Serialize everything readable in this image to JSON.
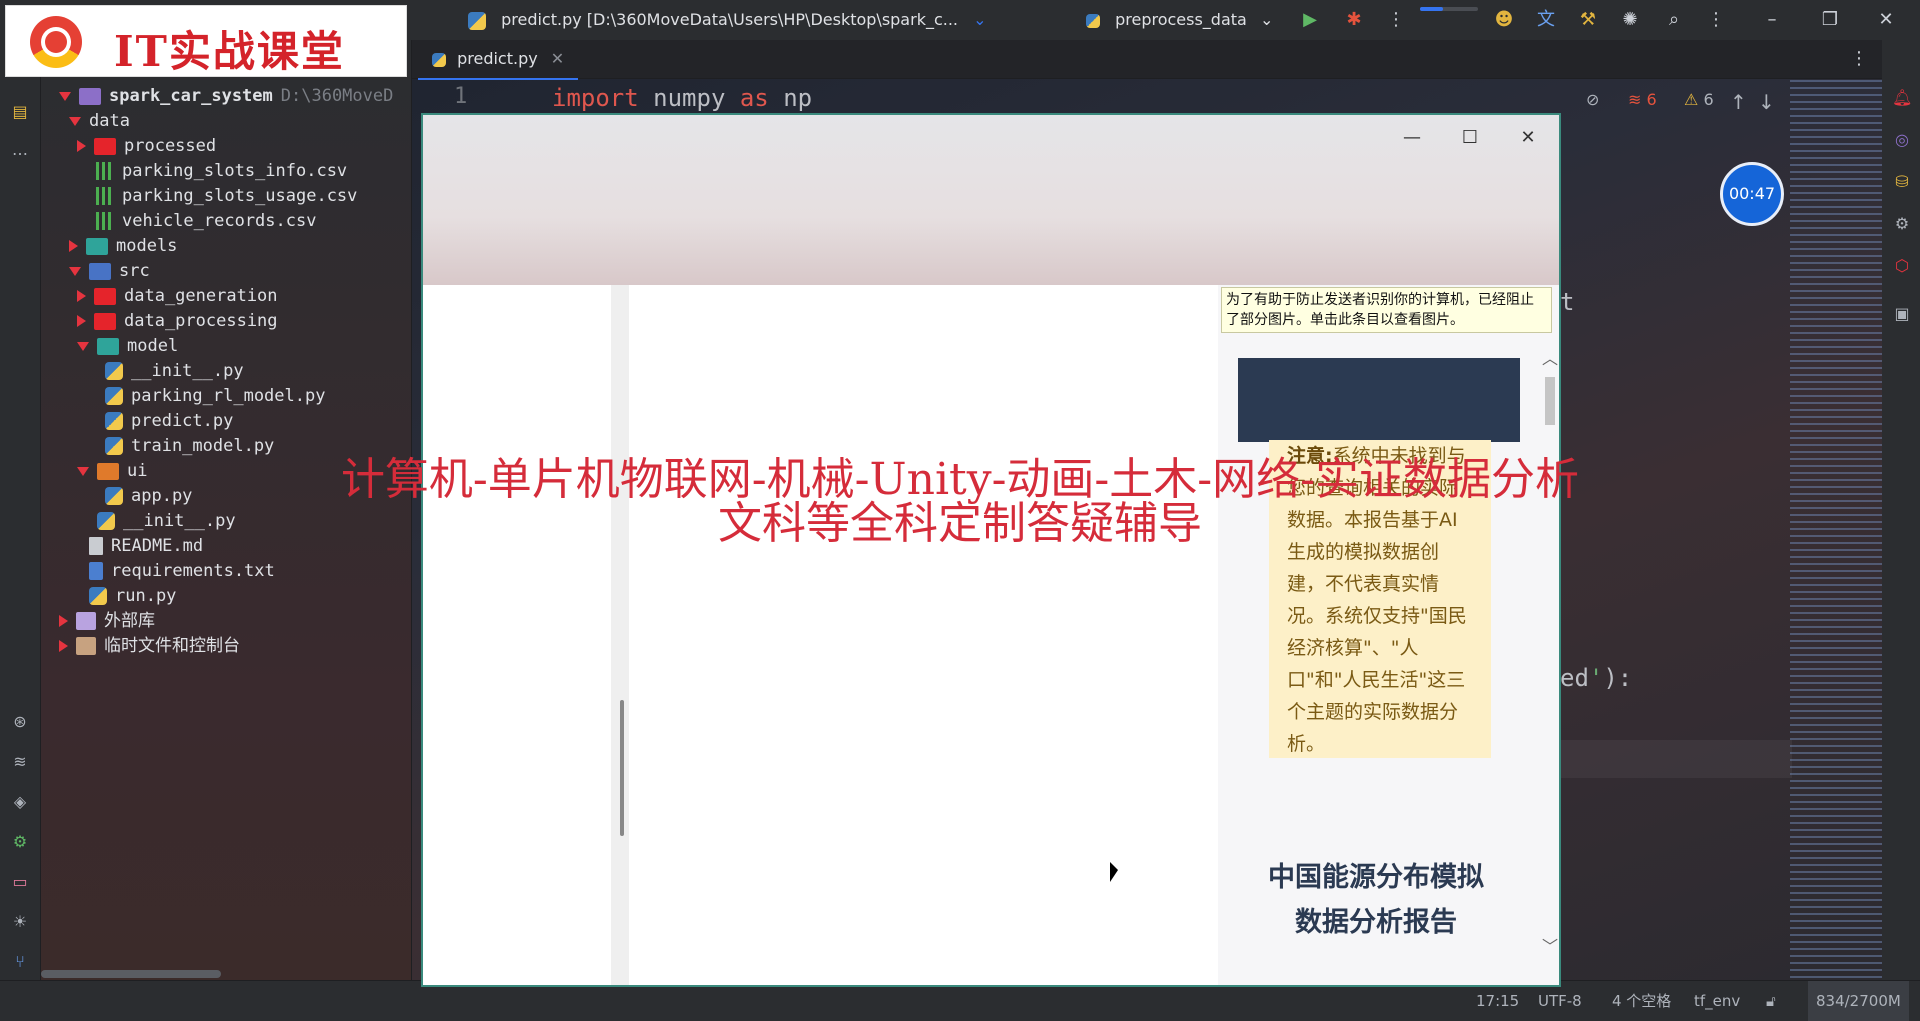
{
  "watermark": {
    "logo_text": "IT实战课堂",
    "overlay_line1": "计算机-单片机物联网-机械-Unity-动画-土木-网络-实证数据分析",
    "overlay_line2": "文科等全科定制答疑辅导"
  },
  "topbar": {
    "file_title": "predict.py [D:\\360MoveData\\Users\\HP\\Desktop\\spark_c...",
    "run_config": "preprocess_data",
    "icons": [
      "python-icon",
      "chevron-down-icon",
      "run-icon",
      "debug-icon",
      "more-icon",
      "collab-icon",
      "translate-icon",
      "build-icon",
      "ai-icon",
      "search-icon",
      "more-vert-icon",
      "minimize-icon",
      "restore-icon",
      "close-icon"
    ]
  },
  "project": {
    "root_name": "spark_car_system",
    "root_path": "D:\\360MoveD",
    "items": [
      {
        "label": "data"
      },
      {
        "label": "processed"
      },
      {
        "label": "parking_slots_info.csv"
      },
      {
        "label": "parking_slots_usage.csv"
      },
      {
        "label": "vehicle_records.csv"
      },
      {
        "label": "models"
      },
      {
        "label": "src"
      },
      {
        "label": "data_generation"
      },
      {
        "label": "data_processing"
      },
      {
        "label": "model"
      },
      {
        "label": "__init__.py"
      },
      {
        "label": "parking_rl_model.py"
      },
      {
        "label": "predict.py"
      },
      {
        "label": "train_model.py"
      },
      {
        "label": "ui"
      },
      {
        "label": "app.py"
      },
      {
        "label": "__init__.py"
      },
      {
        "label": "README.md"
      },
      {
        "label": "requirements.txt"
      },
      {
        "label": "run.py"
      },
      {
        "label": "外部库"
      },
      {
        "label": "临时文件和控制台"
      }
    ]
  },
  "editor": {
    "tab_label": "predict.py",
    "line_number": "1",
    "code": {
      "kw1": "import",
      "mod": " numpy ",
      "kw2": "as",
      "alias": " np"
    },
    "frag_t": "t",
    "frag_ed_pre": "ed",
    "frag_ed_str": "'",
    "frag_ed_post": "):",
    "warn_count_hidden": "6",
    "warn_count": "6"
  },
  "timer": "00:47",
  "popup": {
    "blocked_notice": "为了有助于防止发送者识别你的计算机，已经阻止了部分图片。单击此条目以查看图片。",
    "notice_label": "注意:",
    "notice_text": "系统中未找到与您的查询相关的实际数据。本报告基于AI生成的模拟数据创建，不代表真实情况。系统仅支持\"国民经济核算\"、\"人口\"和\"人民生活\"这三个主题的实际数据分析。",
    "report_title": "中国能源分布模拟数据分析报告"
  },
  "statusbar": {
    "position": "17:15",
    "encoding": "UTF-8",
    "indent": "4 个空格",
    "interpreter": "tf_env",
    "memory": "834/2700M"
  }
}
